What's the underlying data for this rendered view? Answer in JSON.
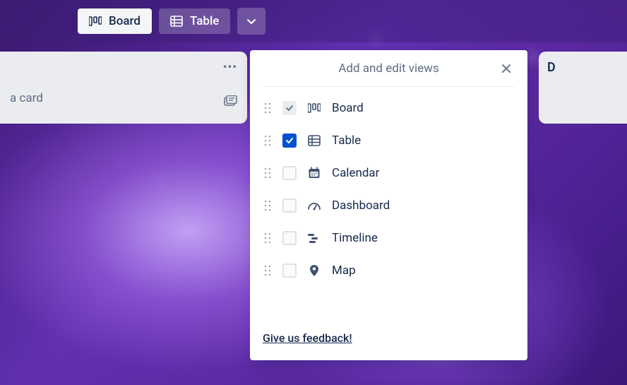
{
  "toolbar": {
    "board_tab": "Board",
    "table_tab": "Table"
  },
  "cards": {
    "add_card_text": "a card",
    "right_card_heading": "D"
  },
  "popover": {
    "title": "Add and edit views",
    "feedback": "Give us feedback!",
    "views": [
      {
        "label": "Board",
        "icon": "board",
        "checkbox": "locked"
      },
      {
        "label": "Table",
        "icon": "table",
        "checkbox": "checked"
      },
      {
        "label": "Calendar",
        "icon": "calendar",
        "checkbox": "unchecked"
      },
      {
        "label": "Dashboard",
        "icon": "dashboard",
        "checkbox": "unchecked"
      },
      {
        "label": "Timeline",
        "icon": "timeline",
        "checkbox": "unchecked"
      },
      {
        "label": "Map",
        "icon": "map",
        "checkbox": "unchecked"
      }
    ]
  }
}
